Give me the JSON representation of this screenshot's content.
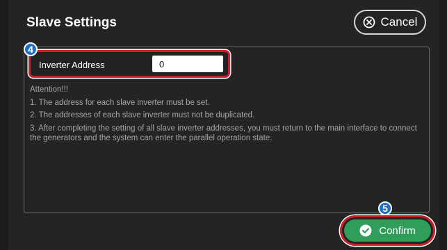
{
  "window": {
    "title": "Slave Settings"
  },
  "cancel_button": {
    "label": "Cancel"
  },
  "inverter_address": {
    "label": "Inverter Address",
    "value": "0"
  },
  "callouts": {
    "address_row": "4",
    "confirm": "5"
  },
  "attention": {
    "heading": "Attention!!!",
    "notes": [
      "1. The address for each slave inverter must be set.",
      "2. The addresses of each slave inverter must not be duplicated.",
      "3. After completing the setting of all slave inverter addresses, you must return to the main interface to connect the generators and the system can enter the parallel operation state."
    ]
  },
  "confirm_button": {
    "label": "Confirm"
  },
  "colors": {
    "background": "#242424",
    "highlight": "#cc1f2a",
    "badge": "#1e6fc4",
    "confirm": "#2e9e5a"
  },
  "icons": {
    "cancel": "circle-x-icon",
    "confirm": "check-circle-icon"
  }
}
